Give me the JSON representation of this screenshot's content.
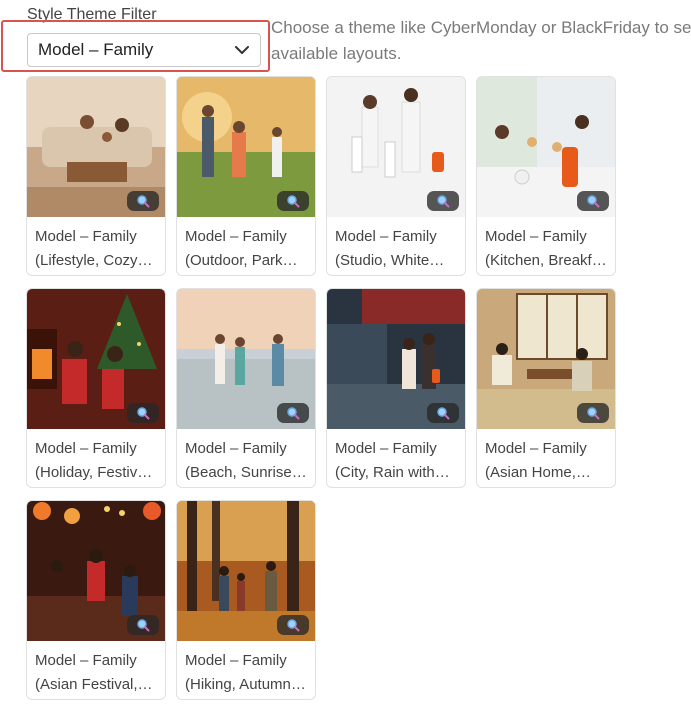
{
  "filter": {
    "label": "Style Theme Filter",
    "selected": "Model – Family",
    "help_text": "Choose a theme like CyberMonday or BlackFriday to see available layouts."
  },
  "colors": {
    "focus_outline": "#d9534f",
    "zoom_bg": "#2c2c2c"
  },
  "cards": [
    {
      "title": "Model – Family",
      "line2": "(Lifestyle, Cozy…",
      "icon": "magnify-icon"
    },
    {
      "title": "Model – Family",
      "line2": "(Outdoor, Park…",
      "icon": "magnify-icon"
    },
    {
      "title": "Model – Family",
      "line2": "(Studio, White…",
      "icon": "magnify-icon"
    },
    {
      "title": "Model – Family",
      "line2": "(Kitchen, Breakfa…",
      "icon": "magnify-icon"
    },
    {
      "title": "Model – Family",
      "line2": "(Holiday, Festive…",
      "icon": "magnify-icon"
    },
    {
      "title": "Model – Family",
      "line2": "(Beach, Sunrise…",
      "icon": "magnify-icon"
    },
    {
      "title": "Model – Family",
      "line2": "(City, Rain with…",
      "icon": "magnify-icon"
    },
    {
      "title": "Model – Family",
      "line2": "(Asian Home,…",
      "icon": "magnify-icon"
    },
    {
      "title": "Model – Family",
      "line2": "(Asian Festival,…",
      "icon": "magnify-icon"
    },
    {
      "title": "Model – Family",
      "line2": "(Hiking, Autumn…",
      "icon": "magnify-icon"
    }
  ]
}
